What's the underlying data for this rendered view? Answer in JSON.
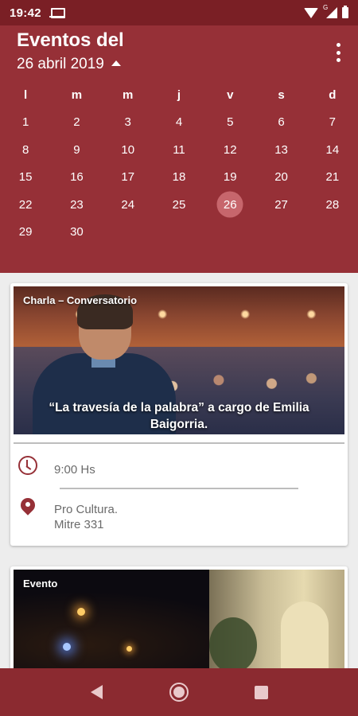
{
  "status_bar": {
    "time": "19:42",
    "signal_label": "G"
  },
  "header": {
    "title": "Eventos del",
    "selected_date": "26 abril 2019",
    "weekdays": [
      "l",
      "m",
      "m",
      "j",
      "v",
      "s",
      "d"
    ],
    "weeks": [
      [
        "1",
        "2",
        "3",
        "4",
        "5",
        "6",
        "7"
      ],
      [
        "8",
        "9",
        "10",
        "11",
        "12",
        "13",
        "14"
      ],
      [
        "15",
        "16",
        "17",
        "18",
        "19",
        "20",
        "21"
      ],
      [
        "22",
        "23",
        "24",
        "25",
        "26",
        "27",
        "28"
      ],
      [
        "29",
        "30",
        "",
        "",
        "",
        "",
        ""
      ]
    ],
    "selected_day": "26"
  },
  "events": [
    {
      "tag": "Charla – Conversatorio",
      "caption": "“La travesía de la palabra” a cargo de Emilia Baigorria.",
      "time": "9:00 Hs",
      "place_line1": "Pro Cultura.",
      "place_line2": "Mitre 331"
    },
    {
      "tag": "Evento"
    }
  ],
  "colors": {
    "header": "#963037",
    "status_bar": "#7a1f25",
    "nav_bar": "#8b2a30",
    "selected_day": "#c7666c",
    "accent": "#963037"
  }
}
